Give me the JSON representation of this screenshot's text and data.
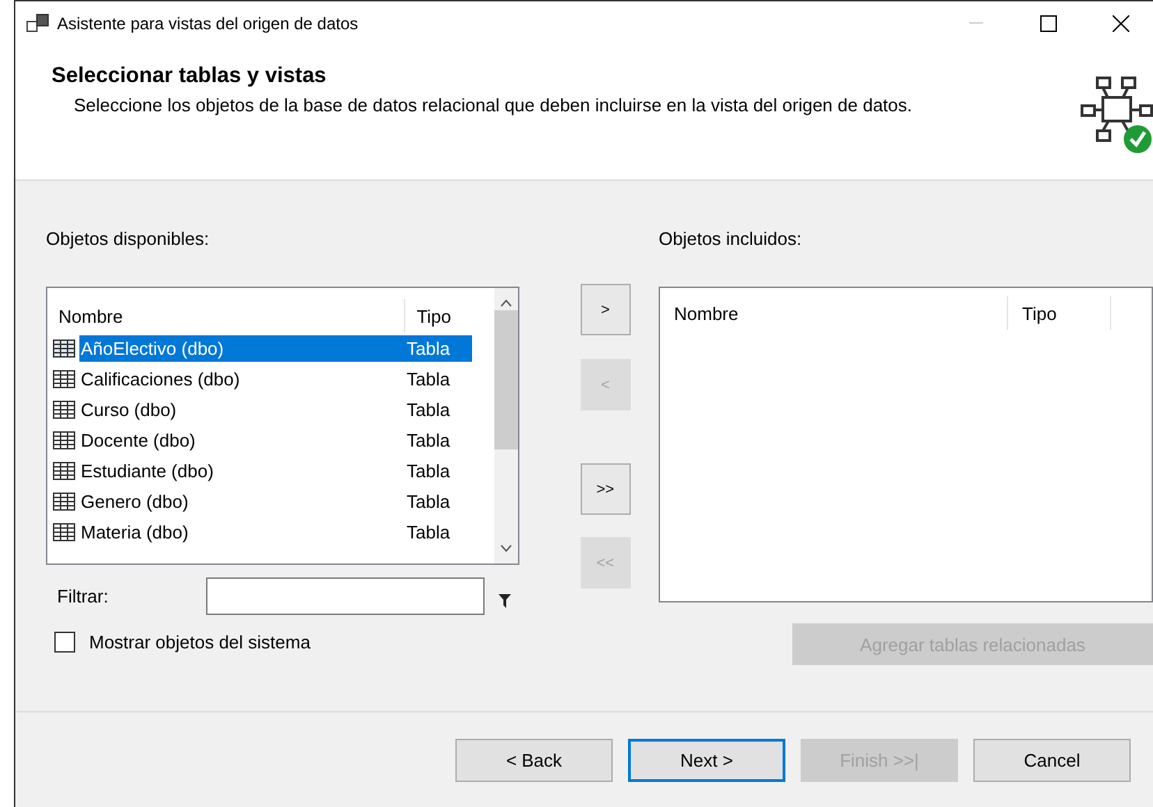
{
  "window": {
    "title": "Asistente para vistas del origen de datos"
  },
  "header": {
    "title": "Seleccionar tablas y vistas",
    "description": "Seleccione los objetos de la base de datos relacional que deben incluirse en la vista del origen de datos."
  },
  "available": {
    "label": "Objetos disponibles:",
    "columns": [
      "Nombre",
      "Tipo"
    ],
    "rows": [
      {
        "name": "AñoElectivo (dbo)",
        "type": "Tabla",
        "selected": true
      },
      {
        "name": "Calificaciones (dbo)",
        "type": "Tabla",
        "selected": false
      },
      {
        "name": "Curso (dbo)",
        "type": "Tabla",
        "selected": false
      },
      {
        "name": "Docente (dbo)",
        "type": "Tabla",
        "selected": false
      },
      {
        "name": "Estudiante (dbo)",
        "type": "Tabla",
        "selected": false
      },
      {
        "name": "Genero (dbo)",
        "type": "Tabla",
        "selected": false
      },
      {
        "name": "Materia (dbo)",
        "type": "Tabla",
        "selected": false
      }
    ]
  },
  "move_buttons": [
    {
      "label": ">",
      "disabled": false
    },
    {
      "label": "<",
      "disabled": true
    },
    {
      "label": ">>",
      "disabled": false
    },
    {
      "label": "<<",
      "disabled": true
    }
  ],
  "included": {
    "label": "Objetos incluidos:",
    "columns": [
      "Nombre",
      "Tipo"
    ]
  },
  "filter": {
    "label": "Filtrar:"
  },
  "related_button": {
    "label": "Agregar tablas relacionadas",
    "disabled": true
  },
  "system_objects": {
    "label": "Mostrar objetos del sistema",
    "checked": false
  },
  "footer_buttons": [
    {
      "label": "< Back",
      "disabled": false,
      "focused": false
    },
    {
      "label": "Next >",
      "disabled": false,
      "focused": true
    },
    {
      "label": "Finish >>|",
      "disabled": true,
      "focused": false
    },
    {
      "label": "Cancel",
      "disabled": false,
      "focused": false
    }
  ]
}
